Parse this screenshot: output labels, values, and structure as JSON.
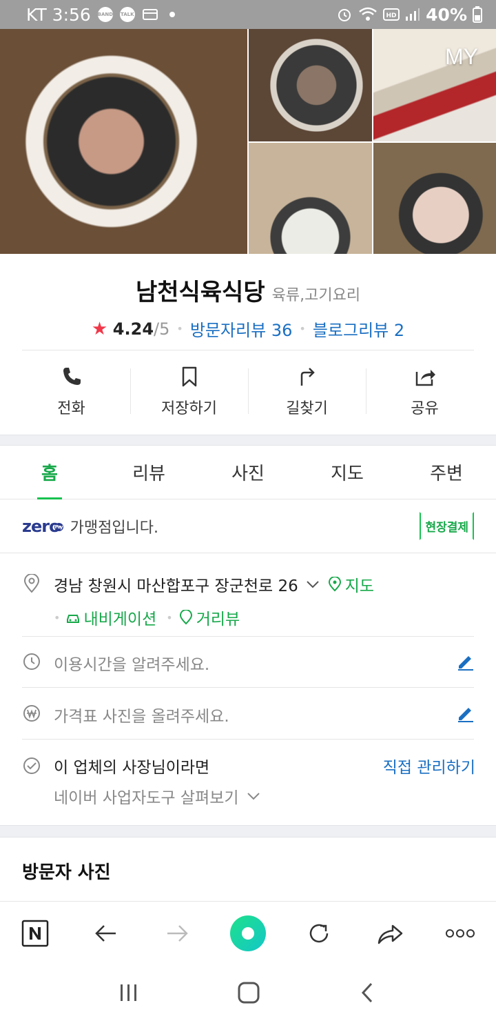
{
  "status_bar": {
    "carrier_time": "KT 3:56",
    "badges": [
      "BAND",
      "TALK"
    ],
    "battery": "40%"
  },
  "photos": {
    "my_label": "MY"
  },
  "place": {
    "name": "남천식육식당",
    "category": "육류,고기요리",
    "rating": "4.24",
    "rating_max": "/5",
    "visitor_reviews": "방문자리뷰 36",
    "blog_reviews": "블로그리뷰 2"
  },
  "actions": [
    {
      "label": "전화",
      "icon": "phone-icon"
    },
    {
      "label": "저장하기",
      "icon": "bookmark-icon"
    },
    {
      "label": "길찾기",
      "icon": "directions-icon"
    },
    {
      "label": "공유",
      "icon": "share-icon"
    }
  ],
  "tabs": [
    "홈",
    "리뷰",
    "사진",
    "지도",
    "주변"
  ],
  "active_tab": "홈",
  "zeropay": {
    "logo": "zero",
    "logo_sub": "Pay",
    "text": "가맹점입니다.",
    "badge": "현장결제"
  },
  "address": {
    "text": "경남 창원시 마산합포구 장군천로 26",
    "map_link": "지도",
    "navigation_link": "내비게이션",
    "street_view_link": "거리뷰"
  },
  "hours": {
    "placeholder": "이용시간을 알려주세요."
  },
  "price": {
    "placeholder": "가격표 사진을 올려주세요."
  },
  "owner": {
    "text": "이 업체의 사장님이라면",
    "manage_link": "직접 관리하기",
    "tools_link": "네이버 사업자도구 살펴보기"
  },
  "visitor_photos_title": "방문자 사진",
  "colors": {
    "accent_green": "#17c24f",
    "link_blue": "#1a6fc2",
    "star_red": "#f0384a"
  }
}
